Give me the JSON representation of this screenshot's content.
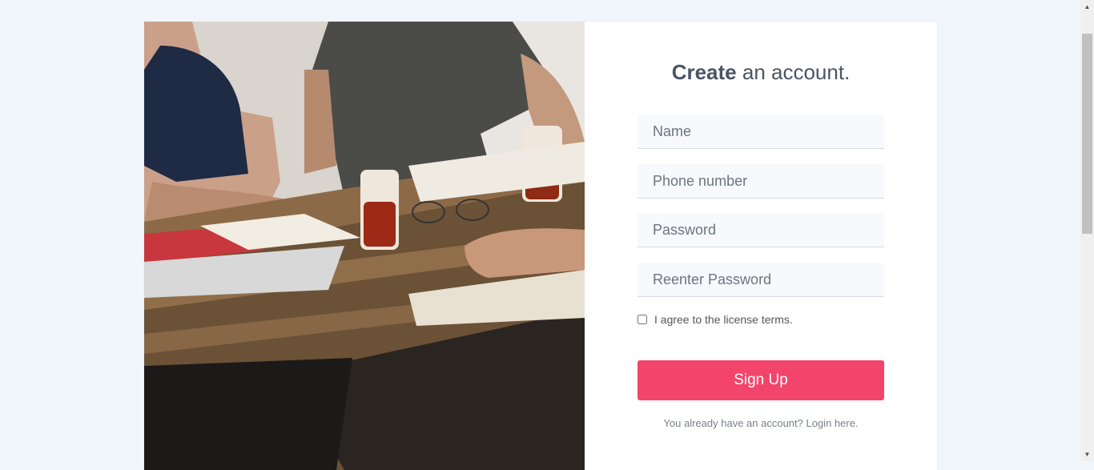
{
  "photo": {
    "description_icon": "people-at-table-image"
  },
  "form": {
    "title_bold": "Create",
    "title_rest": " an account.",
    "fields": [
      {
        "placeholder": "Name",
        "value": ""
      },
      {
        "placeholder": "Phone number",
        "value": ""
      },
      {
        "placeholder": "Password",
        "value": ""
      },
      {
        "placeholder": "Reenter Password",
        "value": ""
      }
    ],
    "agree_label": "I agree to the license terms.",
    "agree_checked": false,
    "submit_label": "Sign Up",
    "login_prompt": "You already have an account? ",
    "login_link": "Login here."
  },
  "colors": {
    "background": "#f1f6fd",
    "accent": "#f3446b",
    "title": "#4a5563"
  }
}
